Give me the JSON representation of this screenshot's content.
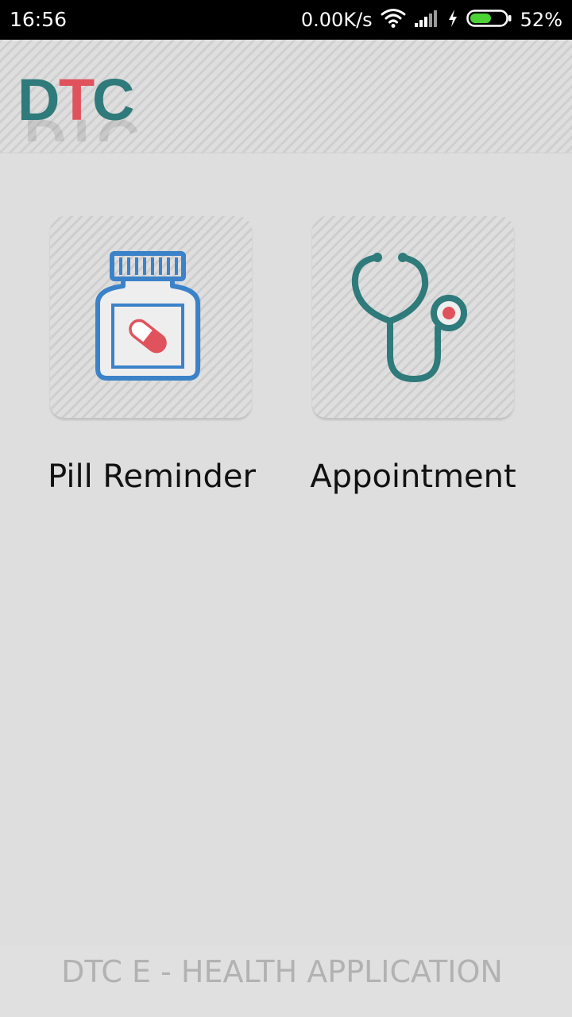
{
  "status_bar": {
    "time": "16:56",
    "net_speed": "0.00K/s",
    "battery": "52%",
    "icons": [
      "wifi-icon",
      "signal-icon",
      "charging-icon",
      "battery-icon"
    ]
  },
  "header": {
    "logo_letters": [
      "D",
      "T",
      "C"
    ],
    "logo_colors": [
      "#2f7a7a",
      "#e0525c",
      "#2f7a7a"
    ]
  },
  "tiles": [
    {
      "label": "Pill Reminder",
      "icon": "pill-bottle-icon",
      "color": "#3b82c8"
    },
    {
      "label": "Appointment",
      "icon": "stethoscope-icon",
      "color": "#2f7a7a"
    }
  ],
  "footer": {
    "text": "DTC E - HEALTH APPLICATION"
  }
}
